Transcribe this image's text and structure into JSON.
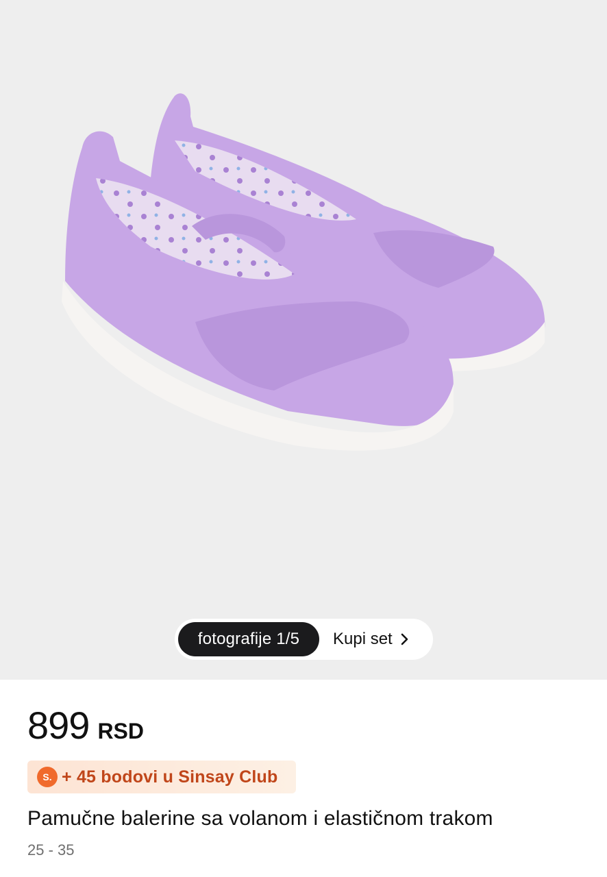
{
  "gallery": {
    "photo_counter": "fotografije 1/5",
    "buy_set_label": "Kupi set",
    "colors": {
      "background": "#eeeeee",
      "shoe": "#c8a6e6"
    }
  },
  "product": {
    "price": "899",
    "currency": "RSD",
    "loyalty": {
      "icon": "sinsay-club-icon",
      "icon_text": "S.",
      "text": "+ 45 bodovi u Sinsay Club",
      "accent": "#f06a2c"
    },
    "name": "Pamučne balerine sa volanom i elastičnom trakom",
    "sizes": "25 - 35"
  }
}
